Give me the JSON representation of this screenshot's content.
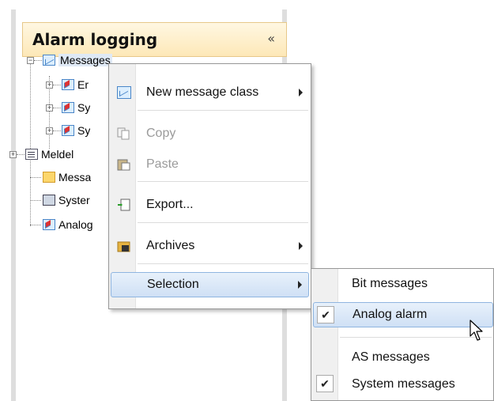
{
  "panel": {
    "title": "Alarm logging",
    "collapse_glyph": "«"
  },
  "tree": {
    "root": {
      "label": "Messages",
      "icon": "envelope-icon",
      "expander": "−"
    },
    "children": [
      {
        "label": "Er",
        "icon": "message-class-icon",
        "expander": "+"
      },
      {
        "label": "Sy",
        "icon": "message-class-icon",
        "expander": "+"
      },
      {
        "label": "Sy",
        "icon": "message-class-icon",
        "expander": "+"
      }
    ],
    "siblings": [
      {
        "label": "Meldel",
        "icon": "document-icon",
        "expander": "+"
      },
      {
        "label": "Messa",
        "icon": "folder-icon",
        "expander": ""
      },
      {
        "label": "Syster",
        "icon": "computer-icon",
        "expander": ""
      },
      {
        "label": "Analog",
        "icon": "analog-alarm-icon",
        "expander": ""
      }
    ]
  },
  "context_menu": {
    "items": [
      {
        "label": "New message class",
        "icon": "envelope-icon",
        "submenu": true,
        "enabled": true
      },
      {
        "label": "Copy",
        "icon": "copy-icon",
        "submenu": false,
        "enabled": false
      },
      {
        "label": "Paste",
        "icon": "paste-icon",
        "submenu": false,
        "enabled": false
      },
      {
        "label": "Export...",
        "icon": "export-icon",
        "submenu": false,
        "enabled": true
      },
      {
        "label": "Archives",
        "icon": "archive-icon",
        "submenu": true,
        "enabled": true
      },
      {
        "label": "Selection",
        "icon": "",
        "submenu": true,
        "enabled": true,
        "active": true
      }
    ]
  },
  "selection_submenu": {
    "items": [
      {
        "label": "Bit messages",
        "checked": false
      },
      {
        "label": "Analog alarm",
        "checked": true,
        "hover": true
      },
      {
        "label": "AS messages",
        "checked": false
      },
      {
        "label": "System messages",
        "checked": true
      }
    ],
    "check_glyph": "✔"
  },
  "colors": {
    "header_bg": "#fde8b8",
    "highlight": "#cfe0f5",
    "highlight_border": "#8fb5e0"
  }
}
